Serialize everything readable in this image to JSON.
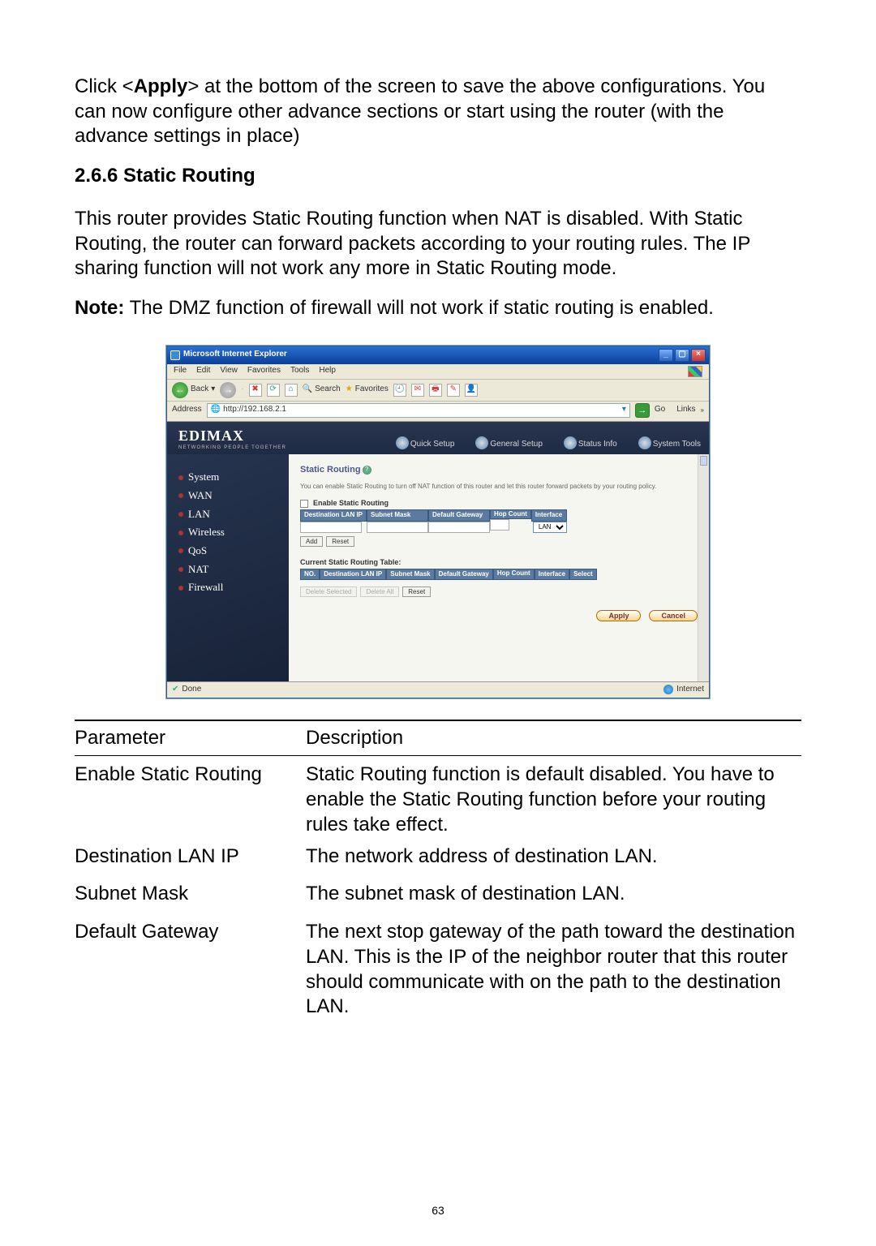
{
  "intro": {
    "pre": "Click <",
    "apply": "Apply",
    "post": "> at the bottom of the screen to save the above configurations. You can now configure other advance sections or start using the router (with the advance settings in place)"
  },
  "section_heading": "2.6.6 Static Routing",
  "section_text": "This router provides Static Routing function when NAT is disabled. With Static Routing, the router can forward packets according to your routing rules. The IP sharing function will not work any more in Static Routing mode.",
  "note_label": "Note:",
  "note_text": " The DMZ function of firewall will not work if static routing is enabled.",
  "ie": {
    "title": "Microsoft Internet Explorer",
    "menu": [
      "File",
      "Edit",
      "View",
      "Favorites",
      "Tools",
      "Help"
    ],
    "toolbar": {
      "back": "Back",
      "search": "Search",
      "favorites": "Favorites"
    },
    "address_label": "Address",
    "address": "http://192.168.2.1",
    "go": "Go",
    "links": "Links",
    "status_done": "Done",
    "status_zone": "Internet"
  },
  "router": {
    "logo": "EDIMAX",
    "logo_sub": "NETWORKING PEOPLE TOGETHER",
    "topnav": [
      "Quick Setup",
      "General Setup",
      "Status Info",
      "System Tools"
    ],
    "sidebar": [
      "System",
      "WAN",
      "LAN",
      "Wireless",
      "QoS",
      "NAT",
      "Firewall"
    ],
    "content": {
      "title": "Static Routing",
      "desc": "You can enable Static Routing to turn off NAT function of this router and let this router forward packets by your routing policy.",
      "enable_label": "Enable Static Routing",
      "cols": [
        "Destination LAN IP",
        "Subnet Mask",
        "Default Gateway",
        "Hop Count",
        "Interface"
      ],
      "iface": "LAN",
      "add": "Add",
      "reset": "Reset",
      "table2_title": "Current Static Routing Table:",
      "cols2": [
        "NO.",
        "Destination LAN IP",
        "Subnet Mask",
        "Default Gateway",
        "Hop Count",
        "Interface",
        "Select"
      ],
      "del_sel": "Delete Selected",
      "del_all": "Delete All",
      "apply": "Apply",
      "cancel": "Cancel"
    }
  },
  "ptable": {
    "h1": "Parameter",
    "h2": "Description",
    "rows": [
      {
        "p": "Enable Static Routing",
        "d": "Static Routing function is default disabled. You have to enable the Static Routing function before your routing rules take effect."
      },
      {
        "p": "Destination LAN IP",
        "d": "The network address of destination LAN."
      },
      {
        "p": "Subnet Mask",
        "d": "The subnet mask of destination LAN."
      },
      {
        "p": "Default Gateway",
        "d": "The next stop gateway of the path toward the destination LAN. This is the IP of the neighbor router that this router should communicate with on the path to the destination LAN."
      }
    ]
  },
  "page_number": "63"
}
